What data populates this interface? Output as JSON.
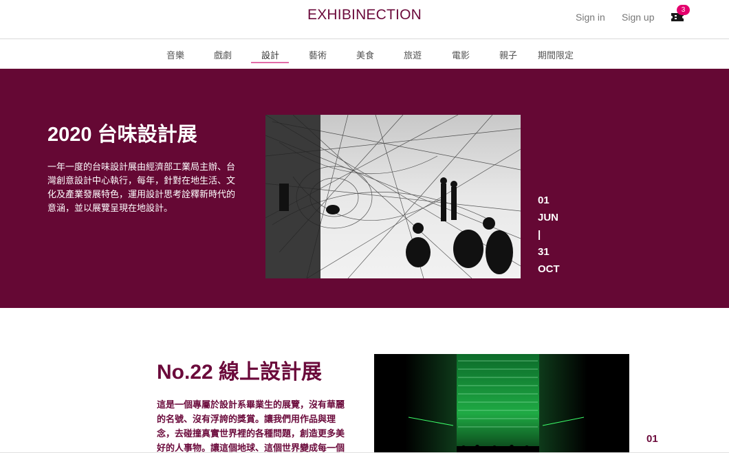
{
  "header": {
    "logo": "EXHIBINECTION",
    "sign_in": "Sign in",
    "sign_up": "Sign up",
    "cart_count": "3",
    "cart_icon": "ticket-icon"
  },
  "categories": [
    {
      "label": "音樂"
    },
    {
      "label": "戲劇"
    },
    {
      "label": "設計"
    },
    {
      "label": "藝術"
    },
    {
      "label": "美食"
    },
    {
      "label": "旅遊"
    },
    {
      "label": "電影"
    },
    {
      "label": "親子"
    },
    {
      "label": "期間限定"
    }
  ],
  "active_category": "設計",
  "colors": {
    "primary": "#650834",
    "accent": "#e4006d",
    "underline": "#e36aa8"
  },
  "featured": {
    "title": "2020 台味設計展",
    "description": "一年一度的台味設計展由經濟部工業局主辦、台灣創意設計中心執行，每年，針對在地生活、文化及產業發展特色，運用設計思考詮釋新時代的意涵，並以展覽呈現在地設計。",
    "date": {
      "start_day": "01",
      "start_month": "JUN",
      "separator": "|",
      "end_day": "31",
      "end_month": "OCT"
    }
  },
  "second": {
    "title": "No.22 線上設計展",
    "description": "這是一個專屬於設計系畢業生的展覽，沒有華麗的名號、沒有浮誇的獎賞。讓我們用作品與理念，去碰撞真實世界裡的各種問題，創造更多美好的人事物。讓這個地球、這個世界變成每一個",
    "date": {
      "start_day": "01"
    }
  }
}
